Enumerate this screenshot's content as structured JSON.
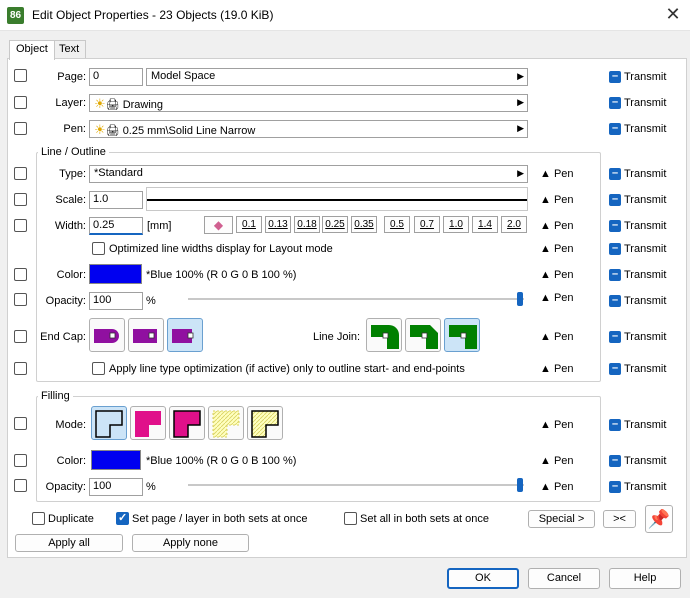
{
  "window": {
    "title": "Edit Object Properties - 23 Objects (19.0 KiB)",
    "app_icon_text": "86",
    "close": "✕"
  },
  "tabs": [
    "Object",
    "Text"
  ],
  "transmit": "Transmit",
  "pen": "▲ Pen",
  "page": {
    "label": "Page:",
    "number": "0",
    "space": "Model Space"
  },
  "layer": {
    "label": "Layer:",
    "value": "Drawing"
  },
  "penrow": {
    "label": "Pen:",
    "value": "0.25 mm\\Solid Line Narrow"
  },
  "line": {
    "title": "Line / Outline",
    "type_label": "Type:",
    "type_value": "*Standard",
    "scale_label": "Scale:",
    "scale_value": "1.0",
    "width_label": "Width:",
    "width_value": "0.25",
    "width_unit": "[mm]",
    "widths": [
      "0.1",
      "0.13",
      "0.18",
      "0.25",
      "0.35",
      "0.5",
      "0.7",
      "1.0",
      "1.4",
      "2.0"
    ],
    "optimized_label": "Optimized line widths display for Layout mode",
    "color_label": "Color:",
    "color_text": "*Blue 100% (R 0 G 0 B 100 %)",
    "color_hex": "#0000f0",
    "opacity_label": "Opacity:",
    "opacity_value": "100",
    "opacity_unit": "%",
    "endcap_label": "End Cap:",
    "linejoin_label": "Line Join:",
    "apply_opt_label": "Apply line type optimization (if active) only to outline start- and end-points"
  },
  "filling": {
    "title": "Filling",
    "mode_label": "Mode:",
    "color_label": "Color:",
    "color_text": "*Blue 100% (R 0 G 0 B 100 %)",
    "opacity_label": "Opacity:",
    "opacity_value": "100",
    "opacity_unit": "%"
  },
  "bottom": {
    "duplicate": "Duplicate",
    "set_page_layer": "Set page / layer in both sets at once",
    "set_all": "Set all in both sets at once",
    "special": "Special >",
    "compare": "><",
    "apply_all": "Apply all",
    "apply_none": "Apply none",
    "ok": "OK",
    "cancel": "Cancel",
    "help": "Help"
  }
}
